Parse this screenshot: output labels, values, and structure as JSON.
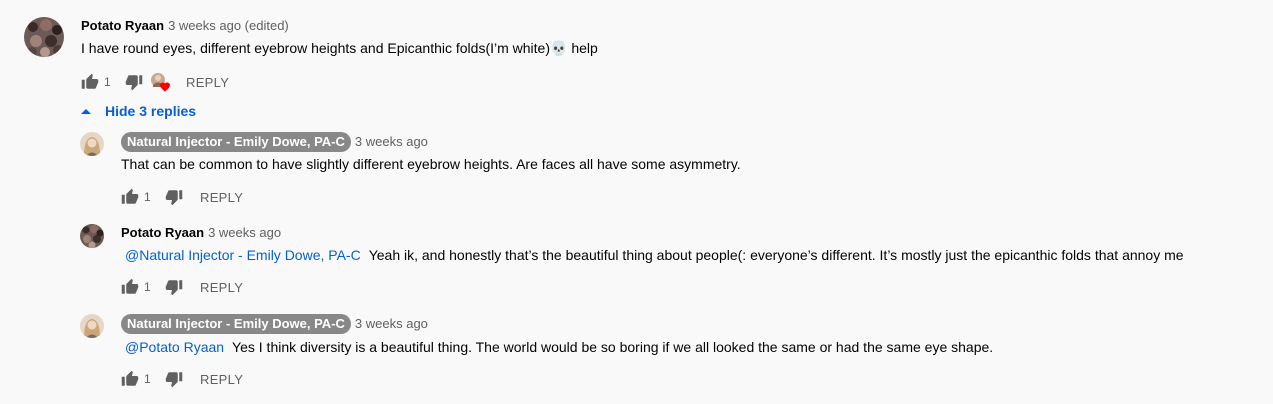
{
  "thread": {
    "hide_replies_label": "Hide 3 replies",
    "top_comment": {
      "author": "Potato Ryaan",
      "time": "3 weeks ago (edited)",
      "text": "I have round eyes, different eyebrow heights and Epicanthic folds(I’m white)💀 help",
      "like_count": "1",
      "reply_label": "REPLY",
      "hearted": true
    },
    "replies": [
      {
        "author": "Natural Injector - Emily Dowe, PA-C",
        "author_is_creator": true,
        "time": "3 weeks ago",
        "mention": "",
        "text": "That can be common to have slightly different eyebrow heights.  Are faces all have some asymmetry.",
        "like_count": "1",
        "reply_label": "REPLY"
      },
      {
        "author": "Potato Ryaan",
        "author_is_creator": false,
        "time": "3 weeks ago",
        "mention": "@Natural Injector - Emily Dowe, PA-C",
        "text": "Yeah ik, and honestly that’s the beautiful thing about people(: everyone’s different. It’s mostly just the epicanthic folds that annoy me",
        "like_count": "1",
        "reply_label": "REPLY"
      },
      {
        "author": "Natural Injector - Emily Dowe, PA-C",
        "author_is_creator": true,
        "time": "3 weeks ago",
        "mention": "@Potato Ryaan",
        "text": "Yes I think diversity is a beautiful thing.  The world would be so boring if we all looked the same or had the same eye shape.",
        "like_count": "1",
        "reply_label": "REPLY"
      }
    ]
  },
  "icons": {
    "like": "thumb-up-icon",
    "dislike": "thumb-down-icon",
    "heart": "heart-icon",
    "collapse": "caret-up-icon"
  },
  "colors": {
    "background": "#f9f9f9",
    "link": "#065fd4",
    "creator_pill": "#888888",
    "secondary_text": "#606060",
    "heart": "#ff0000"
  }
}
